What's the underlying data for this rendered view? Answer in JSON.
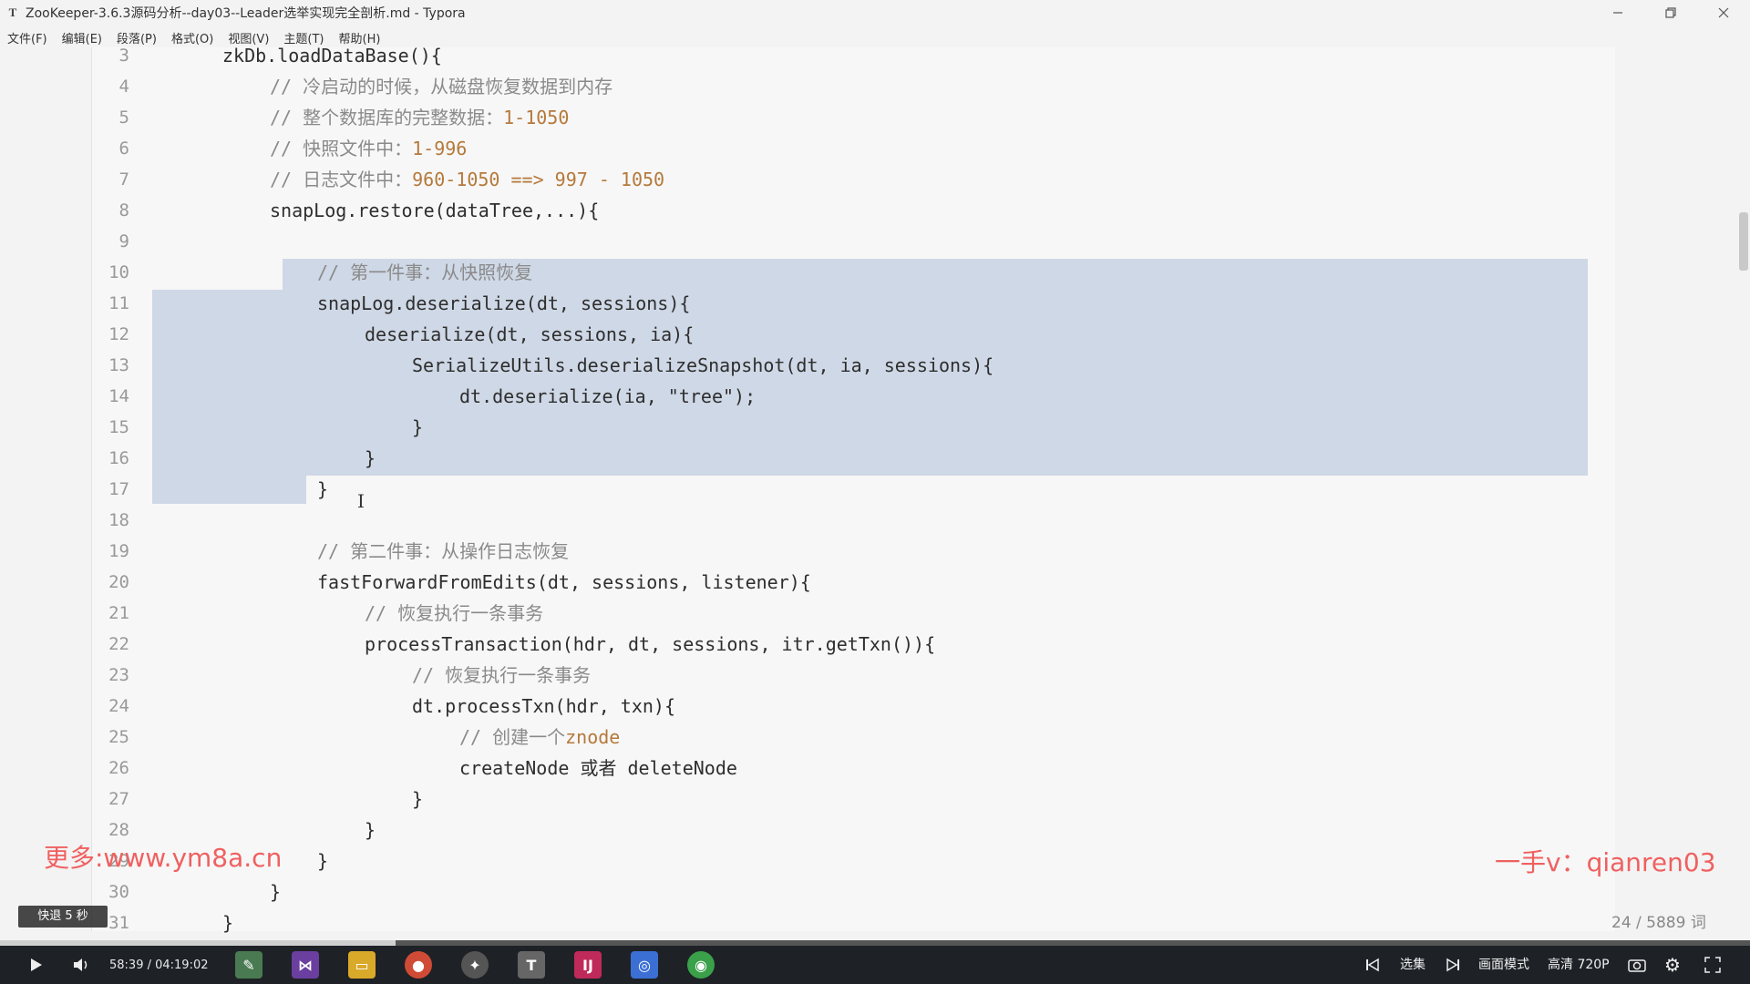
{
  "window": {
    "app_icon": "T",
    "title": "ZooKeeper-3.6.3源码分析--day03--Leader选举实现完全剖析.md - Typora",
    "minimize_icon": "minimize-icon",
    "restore_icon": "restore-icon",
    "close_icon": "close-icon"
  },
  "menu": [
    "文件(F)",
    "编辑(E)",
    "段落(P)",
    "格式(O)",
    "视图(V)",
    "主题(T)",
    "帮助(H)"
  ],
  "editor": {
    "line_numbers": [
      "3",
      "4",
      "5",
      "6",
      "7",
      "8",
      "9",
      "10",
      "11",
      "12",
      "13",
      "14",
      "15",
      "16",
      "17",
      "18",
      "19",
      "20",
      "21",
      "22",
      "23",
      "24",
      "25",
      "26",
      "27",
      "28",
      "29",
      "30",
      "31"
    ],
    "lines": [
      {
        "n": "3",
        "indent": "  ",
        "parts": [
          {
            "t": "zkDb.loadDataBase(){",
            "c": "code"
          }
        ]
      },
      {
        "n": "4",
        "indent": "      ",
        "parts": [
          {
            "t": "// 冷启动的时候，从磁盘恢复数据到内存",
            "c": "cm"
          }
        ]
      },
      {
        "n": "5",
        "indent": "      ",
        "parts": [
          {
            "t": "// 整个数据库的完整数据：",
            "c": "cm"
          },
          {
            "t": "1-1050",
            "c": "num"
          }
        ]
      },
      {
        "n": "6",
        "indent": "      ",
        "parts": [
          {
            "t": "// 快照文件中：",
            "c": "cm"
          },
          {
            "t": "1-996",
            "c": "num"
          }
        ]
      },
      {
        "n": "7",
        "indent": "      ",
        "parts": [
          {
            "t": "// 日志文件中：",
            "c": "cm"
          },
          {
            "t": "960-1050 ==> 997 - 1050",
            "c": "num"
          }
        ]
      },
      {
        "n": "8",
        "indent": "      ",
        "parts": [
          {
            "t": "snapLog.restore(dataTree,...){",
            "c": "code"
          }
        ]
      },
      {
        "n": "9",
        "indent": "",
        "parts": []
      },
      {
        "n": "10",
        "indent": "          ",
        "parts": [
          {
            "t": "// 第一件事：从快照恢复",
            "c": "cm"
          }
        ]
      },
      {
        "n": "11",
        "indent": "          ",
        "parts": [
          {
            "t": "snapLog.deserialize(dt, sessions){",
            "c": "code"
          }
        ]
      },
      {
        "n": "12",
        "indent": "              ",
        "parts": [
          {
            "t": "deserialize(dt, sessions, ia){",
            "c": "code"
          }
        ]
      },
      {
        "n": "13",
        "indent": "                  ",
        "parts": [
          {
            "t": "SerializeUtils.deserializeSnapshot(dt, ia, sessions){",
            "c": "code"
          }
        ]
      },
      {
        "n": "14",
        "indent": "                      ",
        "parts": [
          {
            "t": "dt.deserialize(ia, \"tree\");",
            "c": "code"
          }
        ]
      },
      {
        "n": "15",
        "indent": "                  ",
        "parts": [
          {
            "t": "}",
            "c": "code"
          }
        ]
      },
      {
        "n": "16",
        "indent": "              ",
        "parts": [
          {
            "t": "}",
            "c": "code"
          }
        ]
      },
      {
        "n": "17",
        "indent": "          ",
        "parts": [
          {
            "t": "}",
            "c": "code"
          }
        ]
      },
      {
        "n": "18",
        "indent": "",
        "parts": []
      },
      {
        "n": "19",
        "indent": "          ",
        "parts": [
          {
            "t": "// 第二件事：从操作日志恢复",
            "c": "cm"
          }
        ]
      },
      {
        "n": "20",
        "indent": "          ",
        "parts": [
          {
            "t": "fastForwardFromEdits(dt, sessions, listener){",
            "c": "code"
          }
        ]
      },
      {
        "n": "21",
        "indent": "              ",
        "parts": [
          {
            "t": "// 恢复执行一条事务",
            "c": "cm"
          }
        ]
      },
      {
        "n": "22",
        "indent": "              ",
        "parts": [
          {
            "t": "processTransaction(hdr, dt, sessions, itr.getTxn()){",
            "c": "code"
          }
        ]
      },
      {
        "n": "23",
        "indent": "                  ",
        "parts": [
          {
            "t": "// 恢复执行一条事务",
            "c": "cm"
          }
        ]
      },
      {
        "n": "24",
        "indent": "                  ",
        "parts": [
          {
            "t": "dt.processTxn(hdr, txn){",
            "c": "code"
          }
        ]
      },
      {
        "n": "25",
        "indent": "                      ",
        "parts": [
          {
            "t": "// 创建一个",
            "c": "cm"
          },
          {
            "t": "znode",
            "c": "num"
          }
        ]
      },
      {
        "n": "26",
        "indent": "                      ",
        "parts": [
          {
            "t": "createNode 或者 deleteNode",
            "c": "code"
          }
        ]
      },
      {
        "n": "27",
        "indent": "                  ",
        "parts": [
          {
            "t": "}",
            "c": "code"
          }
        ]
      },
      {
        "n": "28",
        "indent": "              ",
        "parts": [
          {
            "t": "}",
            "c": "code"
          }
        ]
      },
      {
        "n": "29",
        "indent": "          ",
        "parts": [
          {
            "t": "}",
            "c": "code"
          }
        ]
      },
      {
        "n": "30",
        "indent": "      ",
        "parts": [
          {
            "t": "}",
            "c": "code"
          }
        ]
      },
      {
        "n": "31",
        "indent": "  ",
        "parts": [
          {
            "t": "}",
            "c": "code"
          }
        ]
      }
    ]
  },
  "watermark_left": "更多:www.ym8a.cn",
  "watermark_right": "一手v：qianren03",
  "word_count": "24 / 5889 词",
  "toast": "快退 5 秒",
  "player": {
    "time": "58:39 / 04:19:02",
    "progress": 0.226,
    "select_label": "选集",
    "mode_label": "画面模式",
    "quality_label": "高清 720P",
    "play_icon": "play-icon",
    "volume_icon": "volume-icon",
    "prev_icon": "previous-icon",
    "next_icon": "next-icon",
    "screenshot_icon": "camera-icon",
    "settings_icon": "gear-icon",
    "fullscreen_icon": "fullscreen-icon"
  },
  "colors": {
    "comment": "#8a8a8a",
    "number": "#b5793b",
    "selection": "#cfd8e6",
    "watermark": "#f06060"
  }
}
